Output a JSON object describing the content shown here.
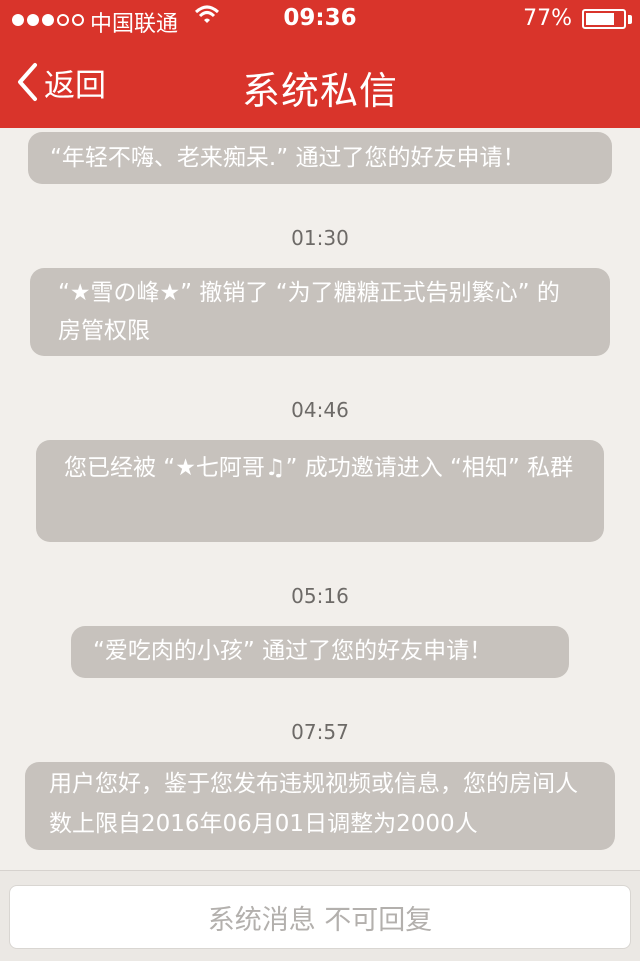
{
  "status_bar": {
    "carrier": "中国联通",
    "time": "09:36",
    "battery_percent": "77%",
    "battery_level": 0.77,
    "signal_strength": 3,
    "signal_max": 5
  },
  "nav": {
    "back_label": "返回",
    "title": "系统私信"
  },
  "messages": [
    {
      "text": "“年轻不嗨、老来痴呆.” 通过了您的好友申请！"
    },
    {
      "time": "01:30",
      "text": "“★雪の峰★” 撤销了 “为了糖糖正式告别繁心” 的房管权限"
    },
    {
      "time": "04:46",
      "text": "您已经被 “★七阿哥♫” 成功邀请进入 “相知” 私群"
    },
    {
      "time": "05:16",
      "text": "“爱吃肉的小孩” 通过了您的好友申请！"
    },
    {
      "time": "07:57",
      "text": "用户您好，鉴于您发布违规视频或信息，您的房间人数上限自2016年06月01日调整为2000人"
    }
  ],
  "footer": {
    "placeholder": "系统消息 不可回复"
  },
  "colors": {
    "header_red": "#d9342b",
    "bubble_gray": "#c7c2bd",
    "background": "#f2efeb"
  }
}
